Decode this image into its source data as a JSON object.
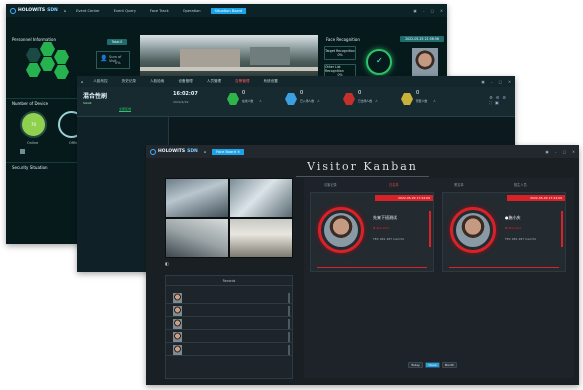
{
  "back_window": {
    "brand": "HOLOWITS",
    "brand_sub": "SDN",
    "tabs": [
      "Event Center",
      "Event Query",
      "Face Track",
      "Operation",
      "Situation Board"
    ],
    "active_tab": "Situation Board",
    "personnel": {
      "title": "Personnel Information",
      "badge": "Total:0",
      "stat_label": "Sum of Visit",
      "stat_value": "0%"
    },
    "device": {
      "title": "Number of Device",
      "online_label": "Online",
      "online_value": "70",
      "offline_label": "Offline"
    },
    "security": {
      "title": "Security Situation"
    },
    "face_recognition": {
      "title": "Face Recognition",
      "datetime": "2022-05-25 21:56:56",
      "target_label": "Target Recognition",
      "target_value": "0%",
      "other_label": "Other List Recognition",
      "other_value": "0%"
    }
  },
  "middle_window": {
    "title": "混合性刷",
    "subtitle": "SGG6",
    "nav": [
      "人脸布控",
      "历史记录",
      "人脸检索",
      "设备管理",
      "人员管理",
      "告警管理",
      "系统设置"
    ],
    "active_nav": "告警管理",
    "time": "16:02:07",
    "date": "2022/4/29",
    "stats": [
      {
        "label": "在线人数",
        "value": "0",
        "unit": "人",
        "color": "#2fb44a"
      },
      {
        "label": "已入场人数",
        "value": "0",
        "unit": "人",
        "color": "#3aa0e0"
      },
      {
        "label": "已出场人数",
        "value": "0",
        "unit": "人",
        "color": "#c4302c"
      },
      {
        "label": "预警人数",
        "value": "0",
        "unit": "人",
        "color": "#c8b23a"
      }
    ],
    "sidebar_item": "全部区域"
  },
  "front_window": {
    "brand": "HOLOWITS",
    "brand_sub": "SDN",
    "tab": "Face Board",
    "heading": "Visitor Kanban",
    "sub_tabs": [
      "访客记录",
      "白名单",
      "黑名单",
      "陌生人员"
    ],
    "cards": [
      {
        "banner": "2022-05-29 17:24:09",
        "name": "先来下班测试",
        "status": "Blacklist",
        "info": "TEC 081 287 Cam34"
      },
      {
        "banner": "2022-05-29 17:24:09",
        "name": "●施小庆",
        "status": "Blacklist",
        "info": "TEC 081 287 Cam34"
      }
    ],
    "list_title": "Records",
    "list_count": 5,
    "footer_buttons": [
      "Today",
      "Week",
      "Month"
    ],
    "active_footer": "Week",
    "accent": "#d82228"
  }
}
